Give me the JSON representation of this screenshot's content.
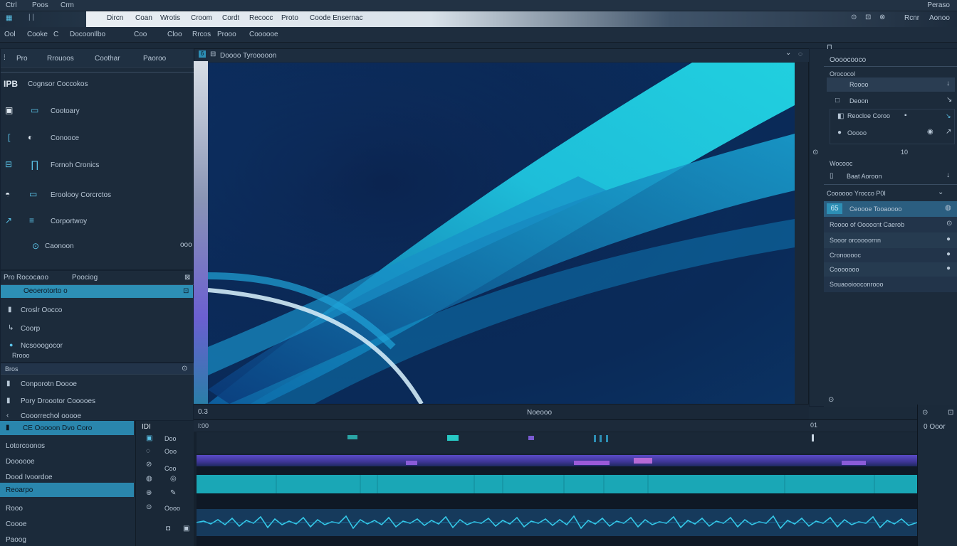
{
  "titlebar": {
    "left_items": [
      "Ctrl",
      "Poos",
      "Crm"
    ],
    "right_label": "Peraso"
  },
  "menubar": {
    "items": [
      "Dircn",
      "Coan",
      "Wrotis",
      "Croom",
      "Cordt",
      "Recocc",
      "Proto",
      "Coode Ensernac"
    ],
    "right": [
      "Rcnr",
      "Aonoo"
    ]
  },
  "toolbar": {
    "items": [
      "Ool",
      "Cooke",
      "C",
      "Docoon",
      "Ilbo",
      "Coo",
      "Cloo",
      "Rrcos",
      "Prooo",
      "Coooooe"
    ]
  },
  "left_panel": {
    "header": [
      "Pro",
      "Rrouoos",
      "Coothar",
      "Paoroo"
    ],
    "items": [
      {
        "icon": "IPB",
        "label": "Cognsor Coccokos"
      },
      {
        "icon": "▣",
        "label": "Cootoary"
      },
      {
        "icon": "◐",
        "label": "Conooce"
      },
      {
        "icon": "∏",
        "label": "Fornoh Cronics"
      },
      {
        "icon": "▭",
        "label": "Eroolooy Corcrctos"
      },
      {
        "icon": "≡",
        "label": "Corportwoy"
      },
      {
        "icon": "⊙",
        "label": "Caonoon"
      }
    ],
    "footer_tag": "ooo"
  },
  "media_panel": {
    "header": [
      "Pro",
      "Rococaoo",
      "Poociog"
    ],
    "selected": "Oeoerotorto o",
    "items": [
      "Croslr Oocco",
      "Coorp",
      "Ncsooogocor"
    ],
    "sub": "Rrooo"
  },
  "effects_panel": {
    "header": "Bros",
    "items": [
      "Conporotn Doooe",
      "Pory Droootor Cooooes",
      "Cooorrechol ooooe"
    ],
    "selected": "CE Ooooon Dvo Coro"
  },
  "bin_list": {
    "items": [
      "Lotorcoonos",
      "Doooooe",
      "Dood Ivoordoe",
      "Reoarpo",
      "Rooo",
      "Coooe",
      "Paoog"
    ]
  },
  "viewer": {
    "tab_number": "6",
    "title": "Doooo Tyrooooon",
    "footer_left": "0.3",
    "footer_center": "Noeooo"
  },
  "inspector": {
    "header": "Oooocooco",
    "section1": "Orococol",
    "rows": [
      "Roooo",
      "Deoon",
      "Reocloe Coroo",
      "Ooooo"
    ],
    "count": "10",
    "section2": "Wocooc",
    "row_b": "Baat Aoroon",
    "section3": "Coooooo Yrocco P0I",
    "selected_badge": "65",
    "selected_label": "Ceoooe Tooaoooo",
    "rows2": [
      "Roooo of Oooocnt Caerob",
      "Sooor orcoooornn",
      "Cronooooc",
      "Cooooooo",
      "Souaooiooconrooo"
    ]
  },
  "timeline": {
    "left_label": "IDI",
    "tool_labels": [
      "Doo",
      "Ooo",
      "Coo",
      "Oooo"
    ],
    "timecode_left": "I:00",
    "timecode_right": "01",
    "right_label": "0 Ooor"
  },
  "colors": {
    "accent": "#2d8fb5",
    "cyan": "#1fd2e4",
    "purple": "#6a53c7",
    "bg": "#1b2a3a"
  }
}
